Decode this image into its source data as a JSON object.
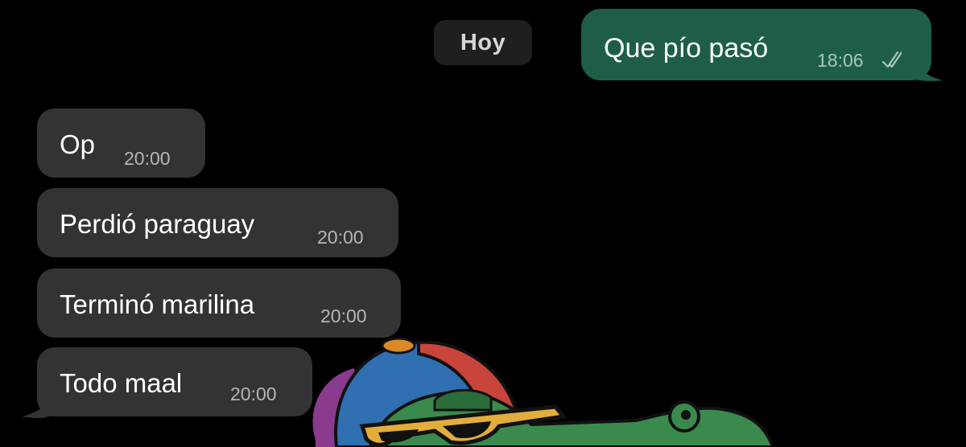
{
  "chat": {
    "date_chip": "Hoy",
    "outgoing": [
      {
        "text": "Que pío pasó",
        "time": "18:06",
        "status": "read-double-check"
      }
    ],
    "incoming": [
      {
        "text": "Op",
        "time": "20:00"
      },
      {
        "text": "Perdió paraguay",
        "time": "20:00"
      },
      {
        "text": "Terminó marilina",
        "time": "20:00"
      },
      {
        "text": "Todo maal",
        "time": "20:00"
      }
    ],
    "sticker": {
      "icon": "crocodile-with-cap-and-sunglasses-sticker"
    }
  },
  "colors": {
    "background": "#000000",
    "outgoing_bubble": "#1e5e47",
    "incoming_bubble": "#333335",
    "date_chip": "#1f1f21"
  }
}
